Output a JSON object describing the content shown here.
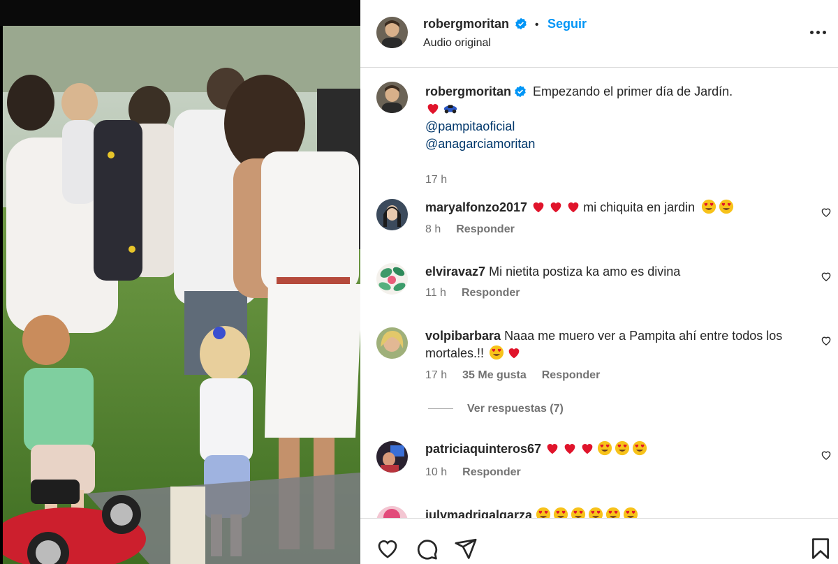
{
  "post": {
    "author": "robergmoritan",
    "follow_label": "Seguir",
    "separator": "•",
    "audio": "Audio original",
    "caption": {
      "username": "robergmoritan",
      "text": "Empezando el primer día de Jardín.",
      "mentions": [
        "@pampitaoficial",
        "@anagarciamoritan"
      ],
      "time": "17 h"
    }
  },
  "comments": [
    {
      "username": "maryalfonzo2017",
      "text": "mi chiquita en jardin",
      "time": "8 h",
      "reply": "Responder",
      "likes": ""
    },
    {
      "username": "elviravaz7",
      "text": "Mi nietita postiza ka amo es divina",
      "time": "11 h",
      "reply": "Responder",
      "likes": ""
    },
    {
      "username": "volpibarbara",
      "text": "Naaa me muero ver a Pampita ahí entre todos los mortales.!!",
      "time": "17 h",
      "reply": "Responder",
      "likes": "35 Me gusta"
    },
    {
      "username": "patriciaquinteros67",
      "text": "",
      "time": "10 h",
      "reply": "Responder",
      "likes": ""
    },
    {
      "username": "julymadrigalgarza",
      "text": "",
      "time": "",
      "reply": "",
      "likes": ""
    }
  ],
  "view_replies": "Ver respuestas (7)",
  "icons": {
    "verified": "verified-badge-icon",
    "more": "more-options-icon",
    "like": "heart-icon",
    "comment": "comment-icon",
    "share": "share-icon",
    "save": "bookmark-icon"
  },
  "colors": {
    "link": "#0095f6",
    "mention": "#00376b",
    "muted": "#737373",
    "heart": "#e0142b"
  }
}
